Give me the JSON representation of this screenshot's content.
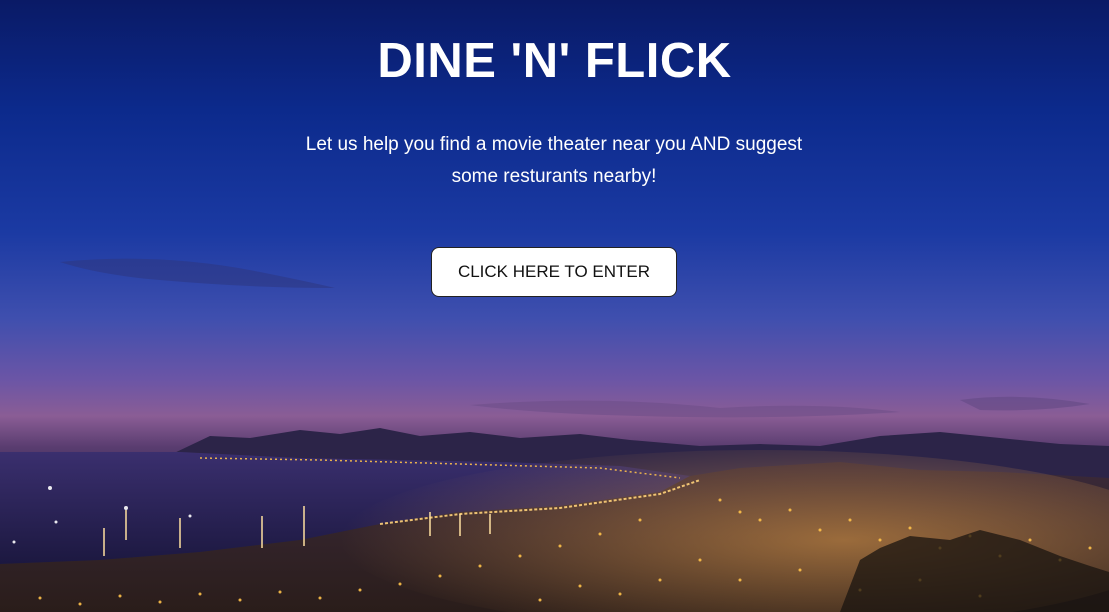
{
  "hero": {
    "title": "DINE 'N' FLICK",
    "tagline": "Let us help you find a movie theater near you AND suggest some resturants nearby!",
    "enter_button_label": "CLICK HERE TO ENTER"
  },
  "colors": {
    "sky_top": "#0a1a66",
    "sky_mid": "#3f4fae",
    "horizon": "#8a5d95",
    "city_lights": "#ffc24a",
    "button_bg": "#ffffff",
    "text": "#ffffff"
  }
}
